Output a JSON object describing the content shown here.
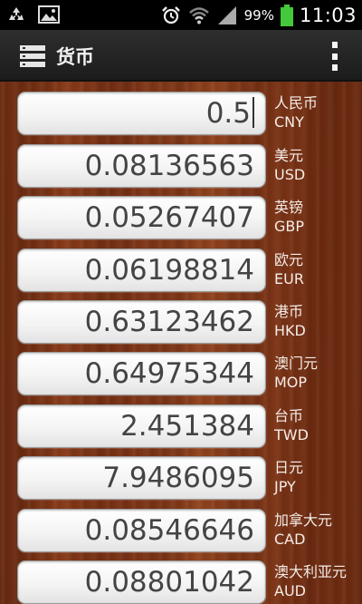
{
  "status_bar": {
    "icons_left": [
      "recycle-icon",
      "image-icon"
    ],
    "icons_right": [
      "alarm-icon",
      "wifi-icon",
      "signal-icon",
      "battery-icon"
    ],
    "battery_percent": "99%",
    "time": "11:03",
    "battery_color": "#44c93b"
  },
  "action_bar": {
    "icon": "app-list-icon",
    "title": "货币",
    "menu_icon": "overflow-menu-icon"
  },
  "rates": [
    {
      "value": "0.5",
      "name": "人民币",
      "code": "CNY",
      "active": true
    },
    {
      "value": "0.08136563",
      "name": "美元",
      "code": "USD"
    },
    {
      "value": "0.05267407",
      "name": "英镑",
      "code": "GBP"
    },
    {
      "value": "0.06198814",
      "name": "欧元",
      "code": "EUR"
    },
    {
      "value": "0.63123462",
      "name": "港币",
      "code": "HKD"
    },
    {
      "value": "0.64975344",
      "name": "澳门元",
      "code": "MOP"
    },
    {
      "value": "2.451384",
      "name": "台币",
      "code": "TWD"
    },
    {
      "value": "7.9486095",
      "name": "日元",
      "code": "JPY"
    },
    {
      "value": "0.08546646",
      "name": "加拿大元",
      "code": "CAD"
    },
    {
      "value": "0.08801042",
      "name": "澳大利亚元",
      "code": "AUD"
    }
  ]
}
